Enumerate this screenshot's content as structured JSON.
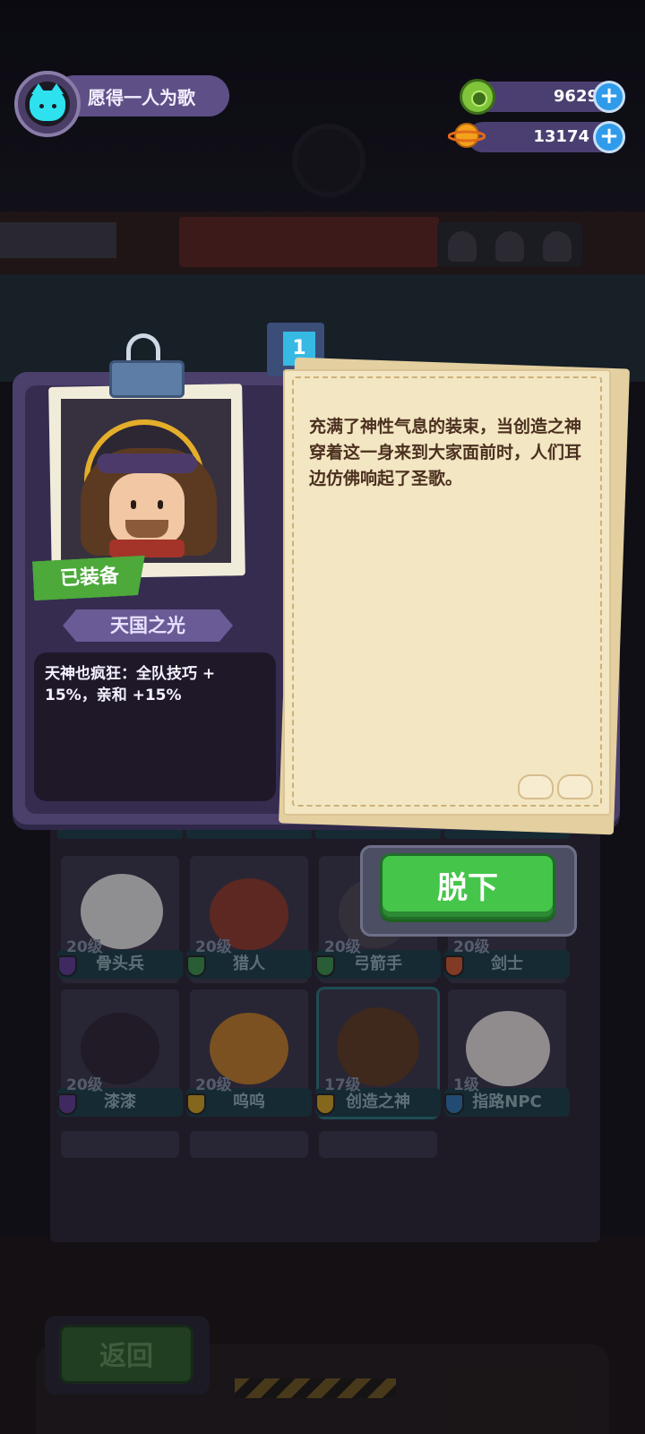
{
  "header": {
    "player_name": "愿得一人为歌",
    "avatar_icon": "cat-face-icon",
    "currency": [
      {
        "icon": "gem-coin-icon",
        "value": "9629",
        "add_label": "+"
      },
      {
        "icon": "planet-coin-icon",
        "value": "13174",
        "add_label": "+"
      }
    ]
  },
  "item_panel": {
    "tab_number": "1",
    "equipped_label": "已装备",
    "costume_name": "天国之光",
    "effect": "天神也疯狂：全队技巧 + 15%，亲和 +15%",
    "description": "充满了神性气息的装束，当创造之神穿着这一身来到大家面前时，人们耳边仿佛响起了圣歌。",
    "take_off_label": "脱下"
  },
  "character_grid": {
    "row1": [
      {
        "level": "20级",
        "name": "骨头兵",
        "shield_color": "#5b3b8c"
      },
      {
        "level": "20级",
        "name": "猎人",
        "shield_color": "#3a8a4a"
      },
      {
        "level": "20级",
        "name": "弓箭手",
        "shield_color": "#3a8a4a"
      },
      {
        "level": "20级",
        "name": "剑士",
        "shield_color": "#c2552e"
      }
    ],
    "row2": [
      {
        "level": "20级",
        "name": "漆漆",
        "shield_color": "#5b3b8c"
      },
      {
        "level": "20级",
        "name": "呜呜",
        "shield_color": "#c79a24"
      },
      {
        "level": "17级",
        "name": "创造之神",
        "shield_color": "#c79a24"
      },
      {
        "level": "1级",
        "name": "指路NPC",
        "shield_color": "#2f6fa8"
      }
    ]
  },
  "footer": {
    "back_label": "返回"
  }
}
